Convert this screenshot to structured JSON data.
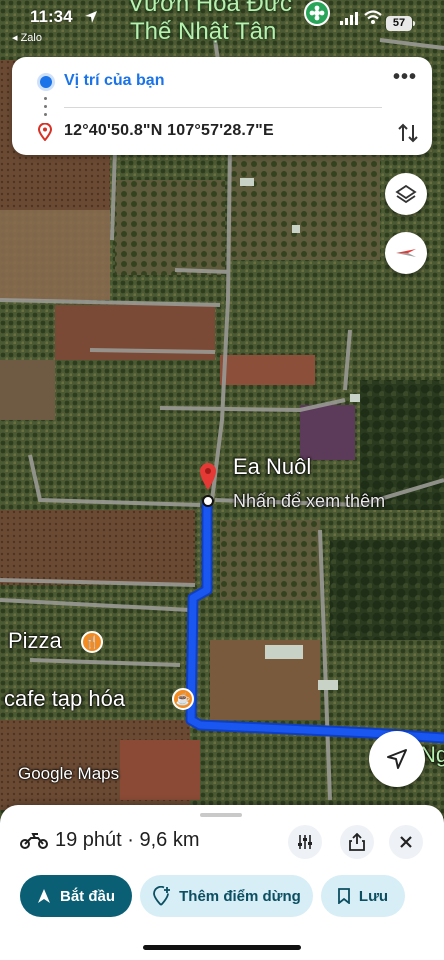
{
  "status_bar": {
    "time": "11:34",
    "back_app": "◂ Zalo",
    "battery": "57"
  },
  "map": {
    "top_label_1": "Vườn Hoa Đức",
    "top_label_2": "Thế Nhật Tân",
    "place_name": "Ea Nuôl",
    "place_hint": "Nhấn để xem thêm",
    "poi_pizza": "Pizza",
    "poi_cafe": "cafe tạp hóa",
    "edge_label": "Ng",
    "attribution": "Google Maps",
    "route_color": "#1a57f0",
    "pin_color": "#e53935"
  },
  "directions": {
    "origin": "Vị trí của bạn",
    "destination": "12°40'50.8\"N 107°57'28.7\"E"
  },
  "sheet": {
    "summary": "19 phút · 9,6 km",
    "start_label": "Bắt đầu",
    "add_stop_label": "Thêm điểm dừng",
    "save_label": "Lưu"
  },
  "colors": {
    "accent": "#0b5f74",
    "chip_bg": "#d7eef7",
    "blue": "#1a73e8"
  }
}
